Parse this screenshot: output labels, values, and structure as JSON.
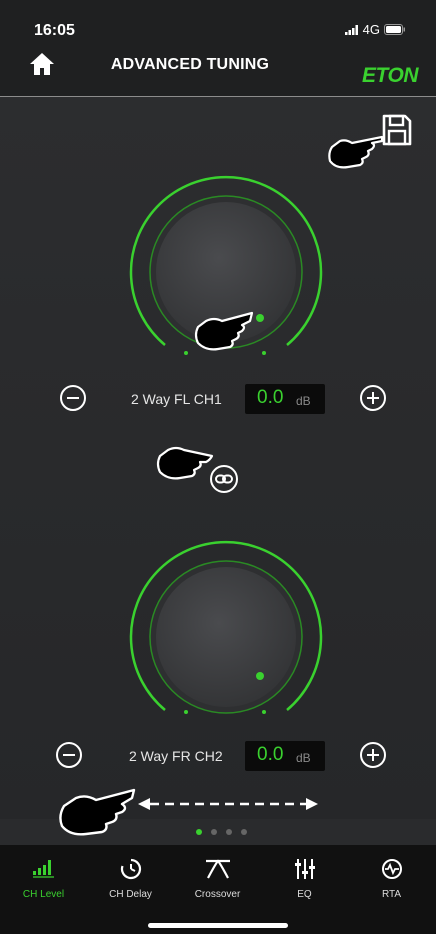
{
  "status_bar": {
    "time": "16:05",
    "network": "4G"
  },
  "header": {
    "title": "ADVANCED TUNING",
    "brand": "ETON"
  },
  "channels": [
    {
      "name": "2 Way FL CH1",
      "value": "0.0",
      "unit": "dB"
    },
    {
      "name": "2 Way FR CH2",
      "value": "0.0",
      "unit": "dB"
    }
  ],
  "pager": {
    "pages": 4,
    "current": 1
  },
  "tabs": [
    {
      "label": "CH Level",
      "icon": "ch-level-icon",
      "active": true
    },
    {
      "label": "CH Delay",
      "icon": "ch-delay-icon",
      "active": false
    },
    {
      "label": "Crossover",
      "icon": "crossover-icon",
      "active": false
    },
    {
      "label": "EQ",
      "icon": "eq-icon",
      "active": false
    },
    {
      "label": "RTA",
      "icon": "rta-icon",
      "active": false
    }
  ],
  "colors": {
    "accent": "#3ad12f",
    "background": "#2a2b2d",
    "bar": "#1f2021",
    "tabbar": "#111111"
  }
}
